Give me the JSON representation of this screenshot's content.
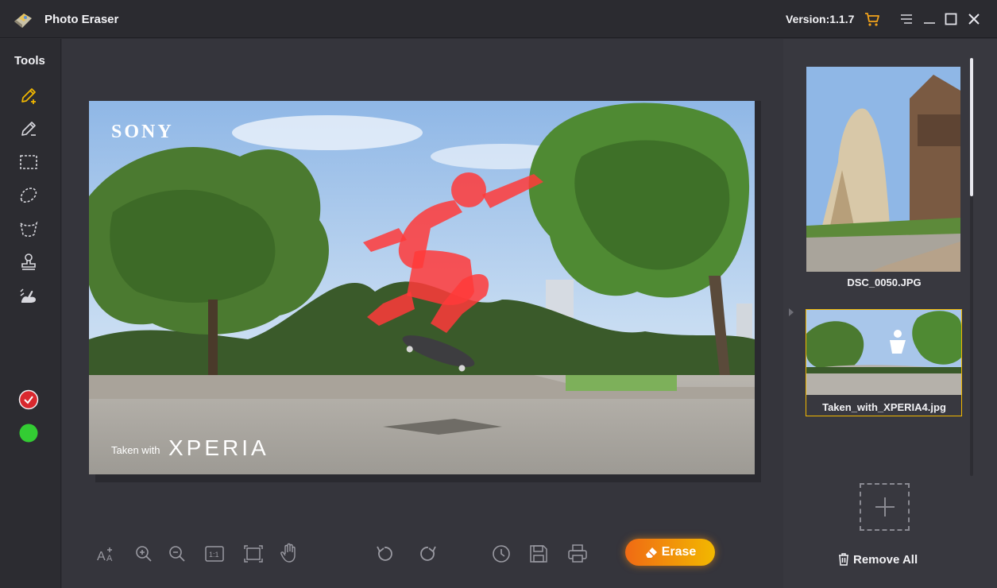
{
  "app": {
    "title": "Photo Eraser",
    "version": "Version:1.1.7"
  },
  "tools": {
    "title": "Tools"
  },
  "photo": {
    "brand": "SONY",
    "watermark_small": "Taken with",
    "watermark_large": "XPERIA"
  },
  "actions": {
    "erase_label": "Erase"
  },
  "files": [
    {
      "name": "DSC_0050.JPG",
      "selected": false
    },
    {
      "name": "Taken_with_XPERIA4.jpg",
      "selected": true
    }
  ],
  "panel": {
    "remove_all_label": "Remove All"
  },
  "colors": {
    "accent_yellow": "#f2b800",
    "accent_orange": "#f06a14",
    "mask_red": "#ff3a3a",
    "status_green": "#33cc33",
    "status_red": "#d9282e"
  },
  "icons": {
    "titlebar": [
      "cart-icon",
      "menu-icon",
      "minimize-icon",
      "maximize-icon",
      "close-icon"
    ],
    "tools": [
      "brush-plus-icon",
      "brush-minus-icon",
      "rectangle-select-icon",
      "lasso-icon",
      "magic-select-icon",
      "stamp-icon",
      "smudge-icon"
    ],
    "bottom": [
      "text-size-icon",
      "zoom-in-icon",
      "zoom-out-icon",
      "actual-size-icon",
      "fit-window-icon",
      "hand-icon",
      "undo-icon",
      "redo-icon",
      "history-icon",
      "save-icon",
      "print-icon"
    ]
  }
}
